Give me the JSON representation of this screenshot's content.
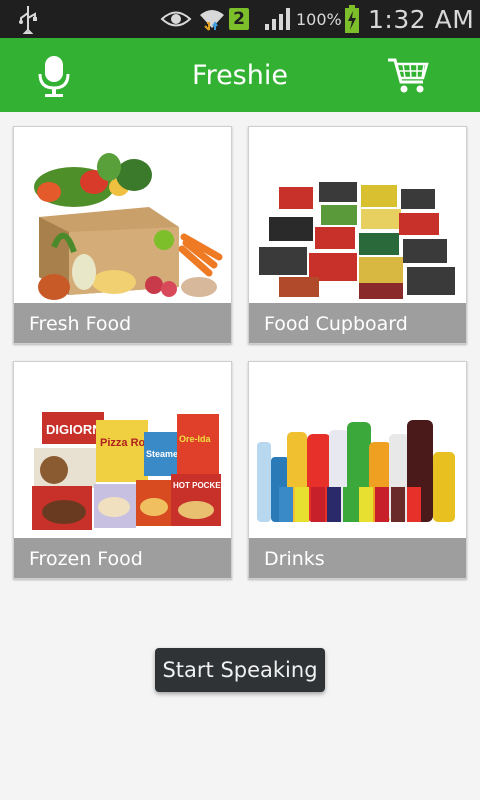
{
  "status_bar": {
    "battery_percent": "100%",
    "time": "1:32 AM",
    "notification_count": "2",
    "icons": [
      "usb-icon",
      "eye-icon",
      "wifi-icon",
      "signal-icon",
      "battery-charging-icon"
    ]
  },
  "header": {
    "title": "Freshie",
    "left_icon": "microphone-icon",
    "right_icon": "shopping-cart-icon",
    "color": "#33b132"
  },
  "categories": [
    {
      "label": "Fresh Food"
    },
    {
      "label": "Food Cupboard"
    },
    {
      "label": "Frozen Food"
    },
    {
      "label": "Drinks"
    }
  ],
  "frozen_brands": [
    "DIGIORNO",
    "Pizza Rolls",
    "Steamers",
    "Ore-Ida",
    "HOT POCKETS"
  ],
  "toast": {
    "text": "Start Speaking"
  }
}
